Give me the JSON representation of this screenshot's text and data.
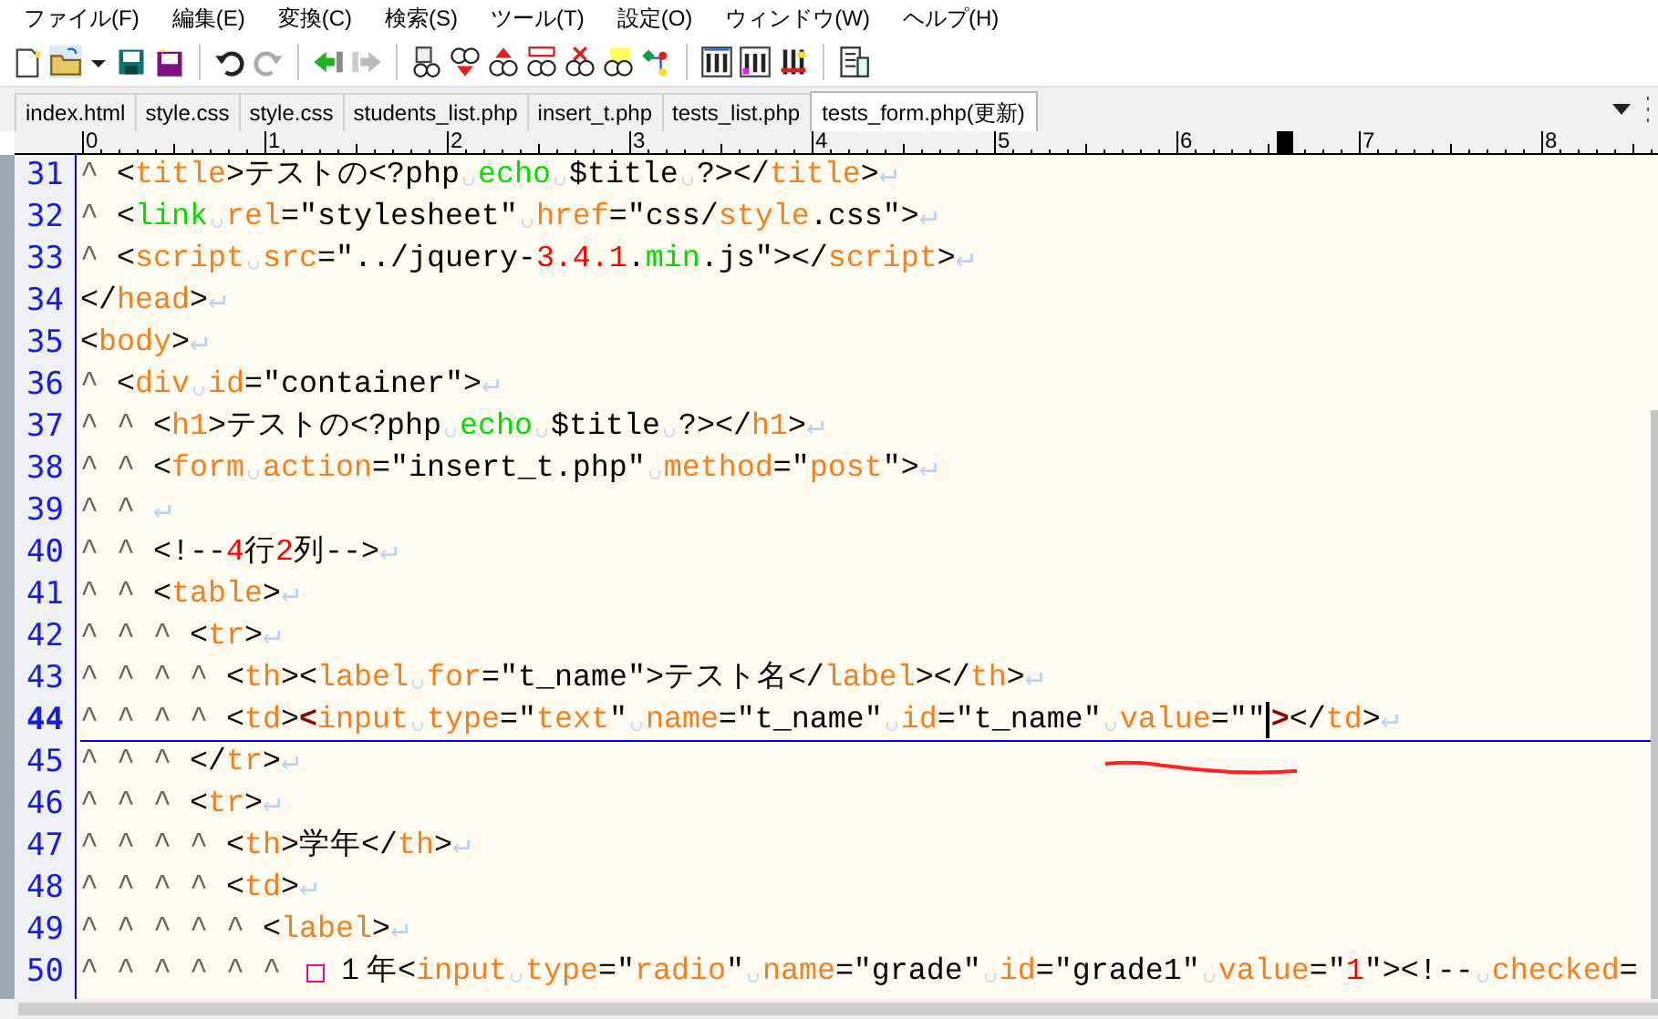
{
  "menu": [
    {
      "label": "ファイル(F)"
    },
    {
      "label": "編集(E)"
    },
    {
      "label": "変換(C)"
    },
    {
      "label": "検索(S)"
    },
    {
      "label": "ツール(T)"
    },
    {
      "label": "設定(O)"
    },
    {
      "label": "ウィンドウ(W)"
    },
    {
      "label": "ヘルプ(H)"
    }
  ],
  "tabs": [
    {
      "label": "index.html",
      "selected": false
    },
    {
      "label": "style.css",
      "selected": false
    },
    {
      "label": "style.css",
      "selected": false
    },
    {
      "label": "students_list.php",
      "selected": false
    },
    {
      "label": "insert_t.php",
      "selected": false
    },
    {
      "label": "tests_list.php",
      "selected": false
    },
    {
      "label": "tests_form.php(更新)",
      "selected": true
    }
  ],
  "ruler": {
    "labels": [
      "0",
      "1",
      "2",
      "3",
      "4",
      "5",
      "6",
      "7",
      "8"
    ]
  },
  "lines": [
    {
      "number": "31",
      "current": false,
      "segments": [
        {
          "kind": "tab",
          "text": "^"
        },
        {
          "kind": "plain",
          "text": "<"
        },
        {
          "kind": "kw",
          "text": "title"
        },
        {
          "kind": "plain",
          "text": ">テストの<?php"
        },
        {
          "kind": "space"
        },
        {
          "kind": "green",
          "text": "echo"
        },
        {
          "kind": "space"
        },
        {
          "kind": "plain",
          "text": "$title"
        },
        {
          "kind": "space"
        },
        {
          "kind": "plain",
          "text": "?></"
        },
        {
          "kind": "kw",
          "text": "title"
        },
        {
          "kind": "plain",
          "text": ">"
        },
        {
          "kind": "eol",
          "text": "↵"
        }
      ]
    },
    {
      "number": "32",
      "current": false,
      "segments": [
        {
          "kind": "tab",
          "text": "^"
        },
        {
          "kind": "plain",
          "text": "<"
        },
        {
          "kind": "green",
          "text": "link"
        },
        {
          "kind": "space"
        },
        {
          "kind": "kw",
          "text": "rel"
        },
        {
          "kind": "plain",
          "text": "=\"stylesheet\""
        },
        {
          "kind": "space"
        },
        {
          "kind": "kw",
          "text": "href"
        },
        {
          "kind": "plain",
          "text": "=\"css/"
        },
        {
          "kind": "kw",
          "text": "style"
        },
        {
          "kind": "plain",
          "text": ".css\">"
        },
        {
          "kind": "eol",
          "text": "↵"
        }
      ]
    },
    {
      "number": "33",
      "current": false,
      "segments": [
        {
          "kind": "tab",
          "text": "^"
        },
        {
          "kind": "plain",
          "text": "<"
        },
        {
          "kind": "kw",
          "text": "script"
        },
        {
          "kind": "space"
        },
        {
          "kind": "kw",
          "text": "src"
        },
        {
          "kind": "plain",
          "text": "=\"../jquery-"
        },
        {
          "kind": "num",
          "text": "3.4.1"
        },
        {
          "kind": "plain",
          "text": "."
        },
        {
          "kind": "green",
          "text": "min"
        },
        {
          "kind": "plain",
          "text": ".js\"></"
        },
        {
          "kind": "kw",
          "text": "script"
        },
        {
          "kind": "plain",
          "text": ">"
        },
        {
          "kind": "eol",
          "text": "↵"
        }
      ]
    },
    {
      "number": "34",
      "current": false,
      "segments": [
        {
          "kind": "plain",
          "text": "</"
        },
        {
          "kind": "kw",
          "text": "head"
        },
        {
          "kind": "plain",
          "text": ">"
        },
        {
          "kind": "eol",
          "text": "↵"
        }
      ]
    },
    {
      "number": "35",
      "current": false,
      "segments": [
        {
          "kind": "plain",
          "text": "<"
        },
        {
          "kind": "kw",
          "text": "body"
        },
        {
          "kind": "plain",
          "text": ">"
        },
        {
          "kind": "eol",
          "text": "↵"
        }
      ]
    },
    {
      "number": "36",
      "current": false,
      "segments": [
        {
          "kind": "tab",
          "text": "^"
        },
        {
          "kind": "plain",
          "text": "<"
        },
        {
          "kind": "kw",
          "text": "div"
        },
        {
          "kind": "space"
        },
        {
          "kind": "kw",
          "text": "id"
        },
        {
          "kind": "plain",
          "text": "=\"container\">"
        },
        {
          "kind": "eol",
          "text": "↵"
        }
      ]
    },
    {
      "number": "37",
      "current": false,
      "segments": [
        {
          "kind": "tab",
          "text": "^"
        },
        {
          "kind": "tab",
          "text": "^"
        },
        {
          "kind": "plain",
          "text": "<"
        },
        {
          "kind": "kw",
          "text": "h1"
        },
        {
          "kind": "plain",
          "text": ">テストの<?php"
        },
        {
          "kind": "space"
        },
        {
          "kind": "green",
          "text": "echo"
        },
        {
          "kind": "space"
        },
        {
          "kind": "plain",
          "text": "$title"
        },
        {
          "kind": "space"
        },
        {
          "kind": "plain",
          "text": "?></"
        },
        {
          "kind": "kw",
          "text": "h1"
        },
        {
          "kind": "plain",
          "text": ">"
        },
        {
          "kind": "eol",
          "text": "↵"
        }
      ]
    },
    {
      "number": "38",
      "current": false,
      "segments": [
        {
          "kind": "tab",
          "text": "^"
        },
        {
          "kind": "tab",
          "text": "^"
        },
        {
          "kind": "plain",
          "text": "<"
        },
        {
          "kind": "kw",
          "text": "form"
        },
        {
          "kind": "space"
        },
        {
          "kind": "kw",
          "text": "action"
        },
        {
          "kind": "plain",
          "text": "=\"insert_t.php\""
        },
        {
          "kind": "space"
        },
        {
          "kind": "kw",
          "text": "method"
        },
        {
          "kind": "plain",
          "text": "=\""
        },
        {
          "kind": "kw",
          "text": "post"
        },
        {
          "kind": "plain",
          "text": "\">"
        },
        {
          "kind": "eol",
          "text": "↵"
        }
      ]
    },
    {
      "number": "39",
      "current": false,
      "segments": [
        {
          "kind": "tab",
          "text": "^"
        },
        {
          "kind": "tab",
          "text": "^"
        },
        {
          "kind": "eol",
          "text": "↵"
        }
      ]
    },
    {
      "number": "40",
      "current": false,
      "segments": [
        {
          "kind": "tab",
          "text": "^"
        },
        {
          "kind": "tab",
          "text": "^"
        },
        {
          "kind": "plain",
          "text": "<!--"
        },
        {
          "kind": "num",
          "text": "4"
        },
        {
          "kind": "plain",
          "text": "行"
        },
        {
          "kind": "num",
          "text": "2"
        },
        {
          "kind": "plain",
          "text": "列-->"
        },
        {
          "kind": "eol",
          "text": "↵"
        }
      ]
    },
    {
      "number": "41",
      "current": false,
      "segments": [
        {
          "kind": "tab",
          "text": "^"
        },
        {
          "kind": "tab",
          "text": "^"
        },
        {
          "kind": "plain",
          "text": "<"
        },
        {
          "kind": "kw",
          "text": "table"
        },
        {
          "kind": "plain",
          "text": ">"
        },
        {
          "kind": "eol",
          "text": "↵"
        }
      ]
    },
    {
      "number": "42",
      "current": false,
      "segments": [
        {
          "kind": "tab",
          "text": "^"
        },
        {
          "kind": "tab",
          "text": "^"
        },
        {
          "kind": "tab",
          "text": "^"
        },
        {
          "kind": "plain",
          "text": "<"
        },
        {
          "kind": "kw",
          "text": "tr"
        },
        {
          "kind": "plain",
          "text": ">"
        },
        {
          "kind": "eol",
          "text": "↵"
        }
      ]
    },
    {
      "number": "43",
      "current": false,
      "segments": [
        {
          "kind": "tab",
          "text": "^"
        },
        {
          "kind": "tab",
          "text": "^"
        },
        {
          "kind": "tab",
          "text": "^"
        },
        {
          "kind": "tab",
          "text": "^"
        },
        {
          "kind": "plain",
          "text": "<"
        },
        {
          "kind": "kw",
          "text": "th"
        },
        {
          "kind": "plain",
          "text": "><"
        },
        {
          "kind": "kw",
          "text": "label"
        },
        {
          "kind": "space"
        },
        {
          "kind": "kw",
          "text": "for"
        },
        {
          "kind": "plain",
          "text": "=\"t_name\">テスト名</"
        },
        {
          "kind": "kw",
          "text": "label"
        },
        {
          "kind": "plain",
          "text": "></"
        },
        {
          "kind": "kw",
          "text": "th"
        },
        {
          "kind": "plain",
          "text": ">"
        },
        {
          "kind": "eol",
          "text": "↵"
        }
      ]
    },
    {
      "number": "44",
      "current": true,
      "segments": [
        {
          "kind": "tab",
          "text": "^"
        },
        {
          "kind": "tab",
          "text": "^"
        },
        {
          "kind": "tab",
          "text": "^"
        },
        {
          "kind": "tab",
          "text": "^"
        },
        {
          "kind": "plain",
          "text": "<"
        },
        {
          "kind": "kw",
          "text": "td"
        },
        {
          "kind": "plain",
          "text": ">"
        },
        {
          "kind": "match",
          "text": "<"
        },
        {
          "kind": "kw",
          "text": "input"
        },
        {
          "kind": "space"
        },
        {
          "kind": "kw",
          "text": "type"
        },
        {
          "kind": "plain",
          "text": "=\""
        },
        {
          "kind": "kw",
          "text": "text"
        },
        {
          "kind": "plain",
          "text": "\""
        },
        {
          "kind": "space"
        },
        {
          "kind": "kw",
          "text": "name"
        },
        {
          "kind": "plain",
          "text": "=\"t_name\""
        },
        {
          "kind": "space"
        },
        {
          "kind": "kw",
          "text": "id"
        },
        {
          "kind": "plain",
          "text": "=\"t_name\""
        },
        {
          "kind": "space"
        },
        {
          "kind": "kw",
          "text": "value"
        },
        {
          "kind": "plain",
          "text": "=\"\""
        },
        {
          "kind": "cursor"
        },
        {
          "kind": "match",
          "text": ">"
        },
        {
          "kind": "plain",
          "text": "</"
        },
        {
          "kind": "kw",
          "text": "td"
        },
        {
          "kind": "plain",
          "text": ">"
        },
        {
          "kind": "eol",
          "text": "↵"
        }
      ]
    },
    {
      "number": "45",
      "current": false,
      "segments": [
        {
          "kind": "tab",
          "text": "^"
        },
        {
          "kind": "tab",
          "text": "^"
        },
        {
          "kind": "tab",
          "text": "^"
        },
        {
          "kind": "plain",
          "text": "</"
        },
        {
          "kind": "kw",
          "text": "tr"
        },
        {
          "kind": "plain",
          "text": ">"
        },
        {
          "kind": "eol",
          "text": "↵"
        }
      ]
    },
    {
      "number": "46",
      "current": false,
      "segments": [
        {
          "kind": "tab",
          "text": "^"
        },
        {
          "kind": "tab",
          "text": "^"
        },
        {
          "kind": "tab",
          "text": "^"
        },
        {
          "kind": "plain",
          "text": "<"
        },
        {
          "kind": "kw",
          "text": "tr"
        },
        {
          "kind": "plain",
          "text": ">"
        },
        {
          "kind": "eol",
          "text": "↵"
        }
      ]
    },
    {
      "number": "47",
      "current": false,
      "segments": [
        {
          "kind": "tab",
          "text": "^"
        },
        {
          "kind": "tab",
          "text": "^"
        },
        {
          "kind": "tab",
          "text": "^"
        },
        {
          "kind": "tab",
          "text": "^"
        },
        {
          "kind": "plain",
          "text": "<"
        },
        {
          "kind": "kw",
          "text": "th"
        },
        {
          "kind": "plain",
          "text": ">学年</"
        },
        {
          "kind": "kw",
          "text": "th"
        },
        {
          "kind": "plain",
          "text": ">"
        },
        {
          "kind": "eol",
          "text": "↵"
        }
      ]
    },
    {
      "number": "48",
      "current": false,
      "segments": [
        {
          "kind": "tab",
          "text": "^"
        },
        {
          "kind": "tab",
          "text": "^"
        },
        {
          "kind": "tab",
          "text": "^"
        },
        {
          "kind": "tab",
          "text": "^"
        },
        {
          "kind": "plain",
          "text": "<"
        },
        {
          "kind": "kw",
          "text": "td"
        },
        {
          "kind": "plain",
          "text": ">"
        },
        {
          "kind": "eol",
          "text": "↵"
        }
      ]
    },
    {
      "number": "49",
      "current": false,
      "segments": [
        {
          "kind": "tab",
          "text": "^"
        },
        {
          "kind": "tab",
          "text": "^"
        },
        {
          "kind": "tab",
          "text": "^"
        },
        {
          "kind": "tab",
          "text": "^"
        },
        {
          "kind": "tab",
          "text": "^"
        },
        {
          "kind": "plain",
          "text": "<"
        },
        {
          "kind": "kw",
          "text": "label"
        },
        {
          "kind": "plain",
          "text": ">"
        },
        {
          "kind": "eol",
          "text": "↵"
        }
      ]
    },
    {
      "number": "50",
      "current": false,
      "segments": [
        {
          "kind": "tab",
          "text": "^"
        },
        {
          "kind": "tab",
          "text": "^"
        },
        {
          "kind": "tab",
          "text": "^"
        },
        {
          "kind": "tab",
          "text": "^"
        },
        {
          "kind": "tab",
          "text": "^"
        },
        {
          "kind": "tab",
          "text": "^"
        },
        {
          "kind": "zspace"
        },
        {
          "kind": "plain",
          "text": "１年<"
        },
        {
          "kind": "kw",
          "text": "input"
        },
        {
          "kind": "space"
        },
        {
          "kind": "kw",
          "text": "type"
        },
        {
          "kind": "plain",
          "text": "=\""
        },
        {
          "kind": "kw",
          "text": "radio"
        },
        {
          "kind": "plain",
          "text": "\""
        },
        {
          "kind": "space"
        },
        {
          "kind": "kw",
          "text": "name"
        },
        {
          "kind": "plain",
          "text": "=\"grade\""
        },
        {
          "kind": "space"
        },
        {
          "kind": "kw",
          "text": "id"
        },
        {
          "kind": "plain",
          "text": "=\"grade1\""
        },
        {
          "kind": "space"
        },
        {
          "kind": "kw",
          "text": "value"
        },
        {
          "kind": "plain",
          "text": "=\""
        },
        {
          "kind": "num",
          "text": "1"
        },
        {
          "kind": "plain",
          "text": "\"><!--"
        },
        {
          "kind": "space"
        },
        {
          "kind": "kw",
          "text": "checked"
        },
        {
          "kind": "plain",
          "text": "="
        }
      ]
    }
  ],
  "annotations": [
    {
      "kind": "hand_drawn_underline"
    }
  ]
}
